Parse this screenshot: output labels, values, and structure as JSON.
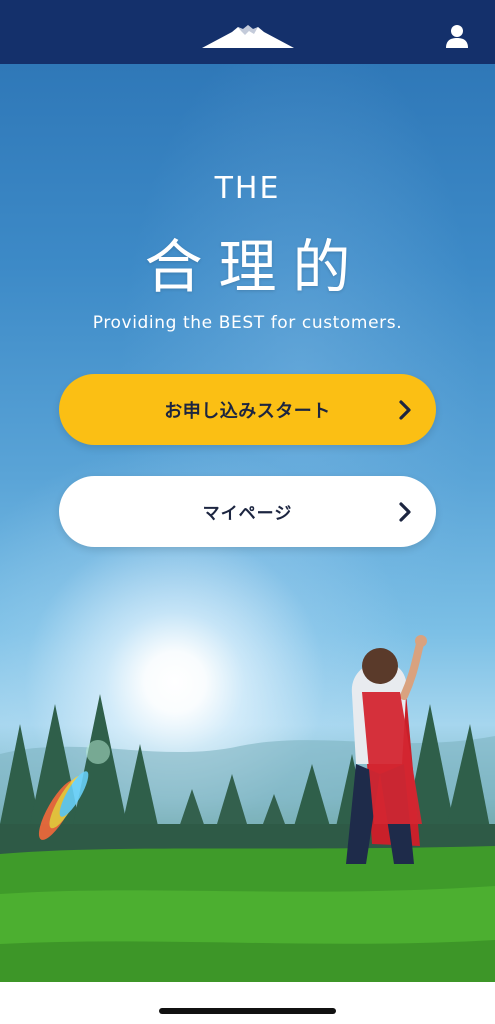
{
  "header": {
    "logo_icon": "mountain-fuji-logo",
    "user_icon": "user-profile-icon",
    "background": "#14306b"
  },
  "hero": {
    "the": "THE",
    "title": "合理的",
    "tagline": "Providing the BEST for customers."
  },
  "buttons": {
    "start_label": "お申し込みスタート",
    "mypage_label": "マイページ",
    "start_color": "#fbbf14",
    "mypage_color": "#ffffff",
    "chevron_icon": "chevron-right-icon"
  }
}
